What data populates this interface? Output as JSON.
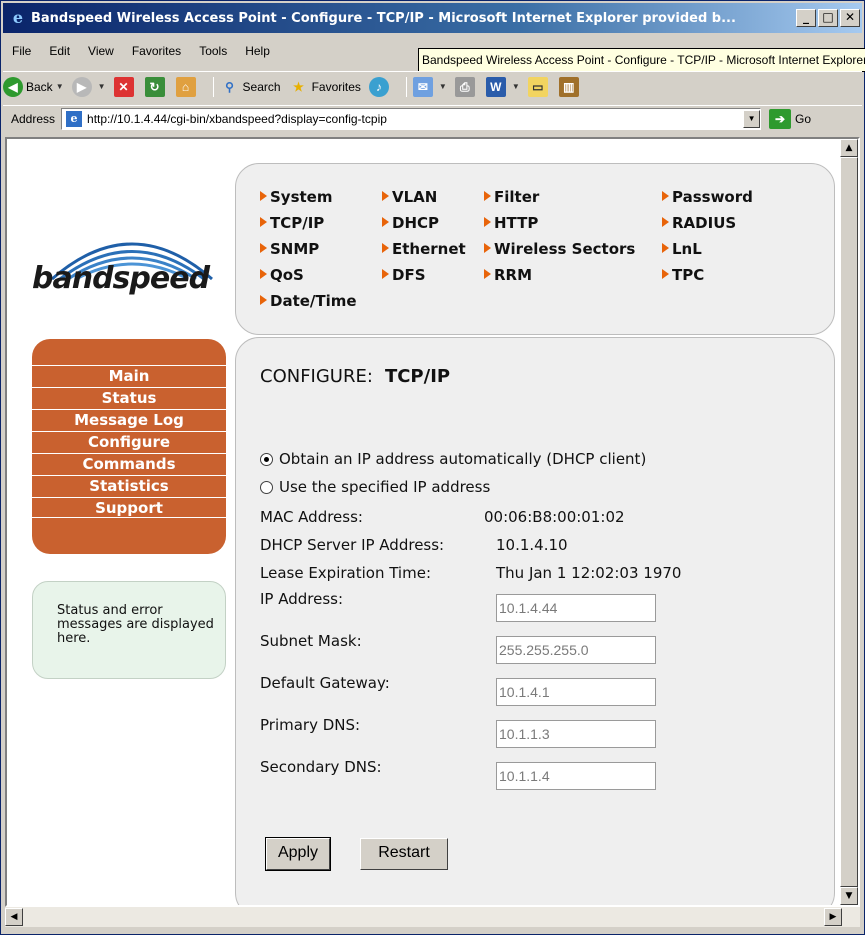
{
  "window": {
    "title": "Bandspeed Wireless Access Point - Configure - TCP/IP - Microsoft Internet Explorer provided b...",
    "tooltip": "Bandspeed Wireless Access Point - Configure - TCP/IP - Microsoft Internet Explorer provided by..."
  },
  "menubar": {
    "items": [
      "File",
      "Edit",
      "View",
      "Favorites",
      "Tools",
      "Help"
    ]
  },
  "toolbar": {
    "back": "Back",
    "search": "Search",
    "favorites": "Favorites"
  },
  "addressbar": {
    "label": "Address",
    "url": "http://10.1.4.44/cgi-bin/xbandspeed?display=config-tcpip",
    "go": "Go"
  },
  "logo": {
    "text": "bandspeed"
  },
  "nav": {
    "items": [
      "System",
      "VLAN",
      "Filter",
      "Password",
      "TCP/IP",
      "DHCP",
      "HTTP",
      "RADIUS",
      "SNMP",
      "Ethernet",
      "Wireless Sectors",
      "LnL",
      "QoS",
      "DFS",
      "RRM",
      "TPC",
      "Date/Time"
    ]
  },
  "sidemenu": {
    "items": [
      "Main",
      "Status",
      "Message Log",
      "Configure",
      "Commands",
      "Statistics",
      "Support"
    ]
  },
  "messages": {
    "text": "Status and error messages are displayed here."
  },
  "configure": {
    "heading": "CONFIGURE:",
    "name": "TCP/IP",
    "radio_dhcp": "Obtain an IP address automatically (DHCP client)",
    "radio_static": "Use the specified IP address",
    "mac_label": "MAC Address:",
    "mac_value": "00:06:B8:00:01:02",
    "dhcp_server_label": "DHCP Server IP Address:",
    "dhcp_server_value": "10.1.4.10",
    "lease_label": "Lease Expiration Time:",
    "lease_value": "Thu Jan 1 12:02:03 1970",
    "ip_label": "IP Address:",
    "ip_value": "10.1.4.44",
    "mask_label": "Subnet Mask:",
    "mask_value": "255.255.255.0",
    "gateway_label": "Default Gateway:",
    "gateway_value": "10.1.4.1",
    "dns1_label": "Primary DNS:",
    "dns1_value": "10.1.1.3",
    "dns2_label": "Secondary DNS:",
    "dns2_value": "10.1.1.4",
    "apply": "Apply",
    "restart": "Restart"
  }
}
